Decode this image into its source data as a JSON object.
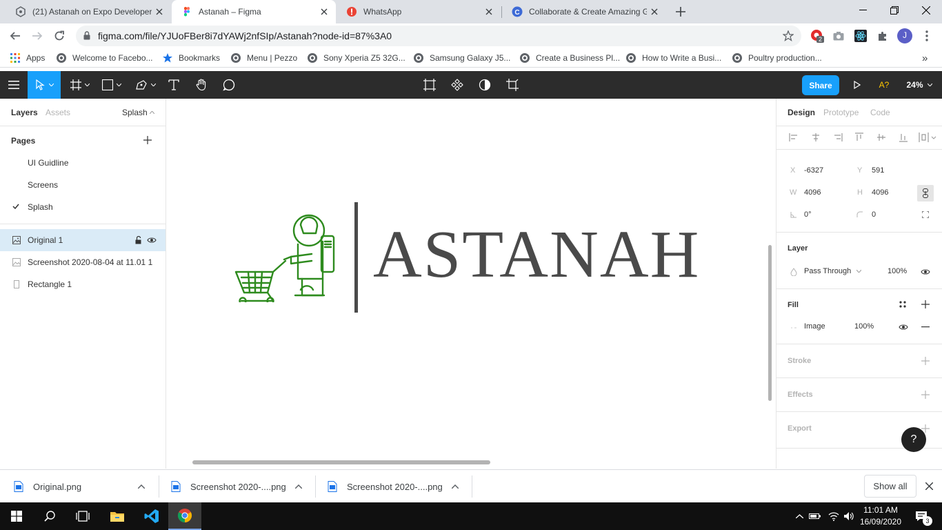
{
  "browser": {
    "tabs": [
      {
        "title": "(21) Astanah on Expo Developer",
        "active": false
      },
      {
        "title": "Astanah – Figma",
        "active": true
      },
      {
        "title": "WhatsApp",
        "active": false
      },
      {
        "title": "Collaborate & Create Amazing G",
        "active": false
      }
    ],
    "url": "figma.com/file/YJUoFBer8i7dYAWj2nfSIp/Astanah?node-id=87%3A0",
    "ext_badge": "2",
    "profile_initial": "J",
    "bookmarks": [
      "Apps",
      "Welcome to Facebo...",
      "Bookmarks",
      "Menu | Pezzo",
      "Sony Xperia Z5 32G...",
      "Samsung Galaxy J5...",
      "Create a Business Pl...",
      "How to Write a Busi...",
      "Poultry production..."
    ],
    "bookmarks_more": "»"
  },
  "figma": {
    "share_label": "Share",
    "font_warning": "A?",
    "zoom": "24%",
    "left_tabs": {
      "layers": "Layers",
      "assets": "Assets",
      "page": "Splash"
    },
    "pages_title": "Pages",
    "pages": [
      {
        "name": "UI Guidline",
        "selected": false
      },
      {
        "name": "Screens",
        "selected": false
      },
      {
        "name": "Splash",
        "selected": true
      }
    ],
    "layers": [
      {
        "name": "Original 1",
        "selected": true
      },
      {
        "name": "Screenshot 2020-08-04 at 11.01 1",
        "selected": false
      },
      {
        "name": "Rectangle 1",
        "selected": false
      }
    ],
    "canvas_logo_text": "ASTANAH",
    "right_tabs": {
      "design": "Design",
      "prototype": "Prototype",
      "code": "Code"
    },
    "props": {
      "x_label": "X",
      "x": "-6327",
      "y_label": "Y",
      "y": "591",
      "w_label": "W",
      "w": "4096",
      "h_label": "H",
      "h": "4096",
      "rotation": "0°",
      "radius": "0"
    },
    "layer_section": {
      "title": "Layer",
      "blend": "Pass Through",
      "opacity": "100%"
    },
    "fill_section": {
      "title": "Fill",
      "type": "Image",
      "opacity": "100%"
    },
    "stroke_title": "Stroke",
    "effects_title": "Effects",
    "export_title": "Export",
    "help": "?"
  },
  "downloads": {
    "items": [
      "Original.png",
      "Screenshot 2020-....png",
      "Screenshot 2020-....png"
    ],
    "show_all": "Show all"
  },
  "taskbar": {
    "time": "11:01 AM",
    "date": "16/09/2020",
    "notification_count": "3"
  },
  "colors": {
    "figma_dark": "#2c2c2c",
    "figma_blue": "#18a0fb",
    "logo_green": "#2e8b1e",
    "logo_text": "#4a4a4a"
  }
}
